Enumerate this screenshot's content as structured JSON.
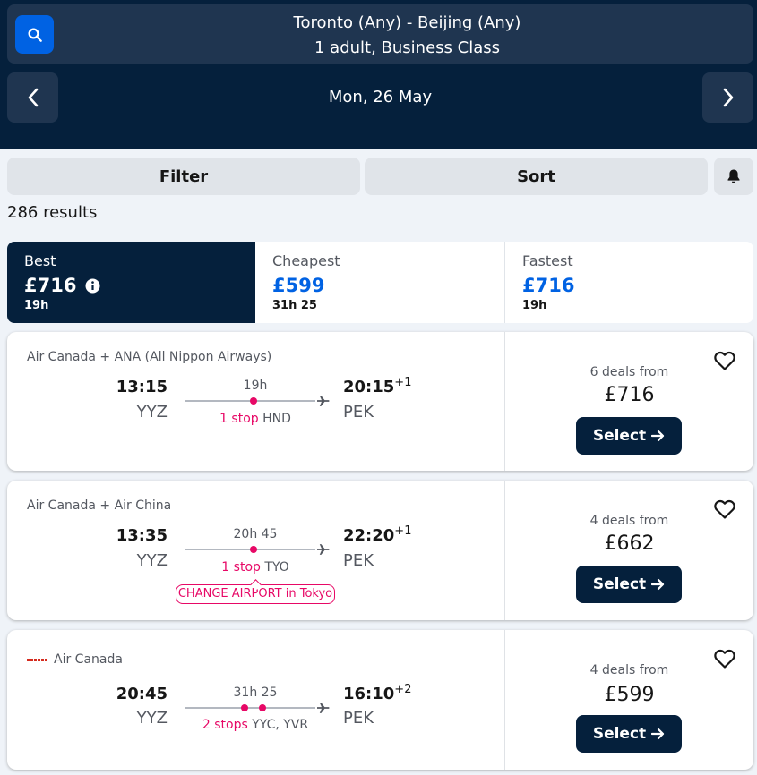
{
  "header": {
    "route": "Toronto (Any) - Beijing (Any)",
    "passengers": "1 adult, Business Class",
    "date": "Mon, 26 May"
  },
  "toolbar": {
    "filter_label": "Filter",
    "sort_label": "Sort"
  },
  "results_count": "286 results",
  "tabs": [
    {
      "title": "Best",
      "price": "£716",
      "duration": "19h"
    },
    {
      "title": "Cheapest",
      "price": "£599",
      "duration": "31h 25"
    },
    {
      "title": "Fastest",
      "price": "£716",
      "duration": "19h"
    }
  ],
  "flights": [
    {
      "airline": "Air Canada + ANA (All Nippon Airways)",
      "dep_time": "13:15",
      "dep_code": "YYZ",
      "arr_time": "20:15",
      "arr_offset": "+1",
      "arr_code": "PEK",
      "duration": "19h",
      "stops": "1 stop",
      "stop_airports": "HND",
      "deals": "6 deals from",
      "price": "£716",
      "select_label": "Select"
    },
    {
      "airline": "Air Canada + Air China",
      "dep_time": "13:35",
      "dep_code": "YYZ",
      "arr_time": "22:20",
      "arr_offset": "+1",
      "arr_code": "PEK",
      "duration": "20h 45",
      "stops": "1 stop",
      "stop_airports": "TYO",
      "warning": "CHANGE AIRPORT in Tokyo",
      "deals": "4 deals from",
      "price": "£662",
      "select_label": "Select"
    },
    {
      "airline": "Air Canada",
      "dep_time": "20:45",
      "dep_code": "YYZ",
      "arr_time": "16:10",
      "arr_offset": "+2",
      "arr_code": "PEK",
      "duration": "31h 25",
      "stops": "2 stops",
      "stop_airports": "YYC, YVR",
      "deals": "4 deals from",
      "price": "£599",
      "select_label": "Select"
    }
  ],
  "colors": {
    "header_bg": "#05203c",
    "accent_blue": "#0062e3",
    "stop_pink": "#e70866"
  }
}
